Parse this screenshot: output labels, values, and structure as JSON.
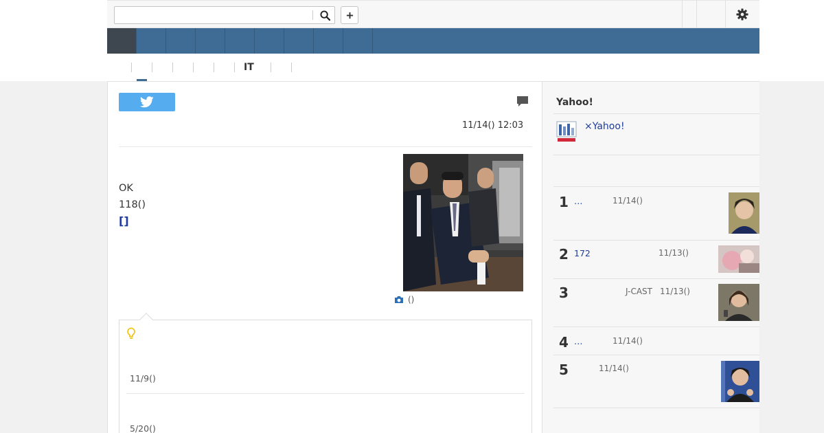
{
  "header": {
    "search_placeholder": "",
    "search_value": ""
  },
  "subnav": {
    "active_label": "IT"
  },
  "article": {
    "published": "11/14() 12:03",
    "lines": [
      "OK",
      "118()"
    ],
    "more_link": "[]",
    "photo_caption": "()"
  },
  "related": {
    "dates": [
      "11/9()",
      "5/20()"
    ]
  },
  "sidebar": {
    "title": "Yahoo!",
    "promo_link": "×Yahoo!",
    "ranking": [
      {
        "rank": "1",
        "title": "…",
        "source": "",
        "date": "11/14()"
      },
      {
        "rank": "2",
        "title": "172",
        "source": "",
        "date": "11/13()"
      },
      {
        "rank": "3",
        "title": "",
        "source": "J-CAST",
        "date": "11/13()"
      },
      {
        "rank": "4",
        "title": "…",
        "source": "",
        "date": "11/14()"
      },
      {
        "rank": "5",
        "title": "",
        "source": "",
        "date": "11/14()"
      }
    ]
  },
  "colors": {
    "nav_blue": "#3f6c95",
    "nav_active": "#3e4650",
    "twitter": "#55acee",
    "link": "#1e3c9e",
    "bulb": "#f2c318"
  },
  "icons": [
    "search-icon",
    "plus-icon",
    "gear-icon",
    "twitter-bird-icon",
    "comment-icon",
    "camera-icon",
    "lightbulb-icon"
  ]
}
